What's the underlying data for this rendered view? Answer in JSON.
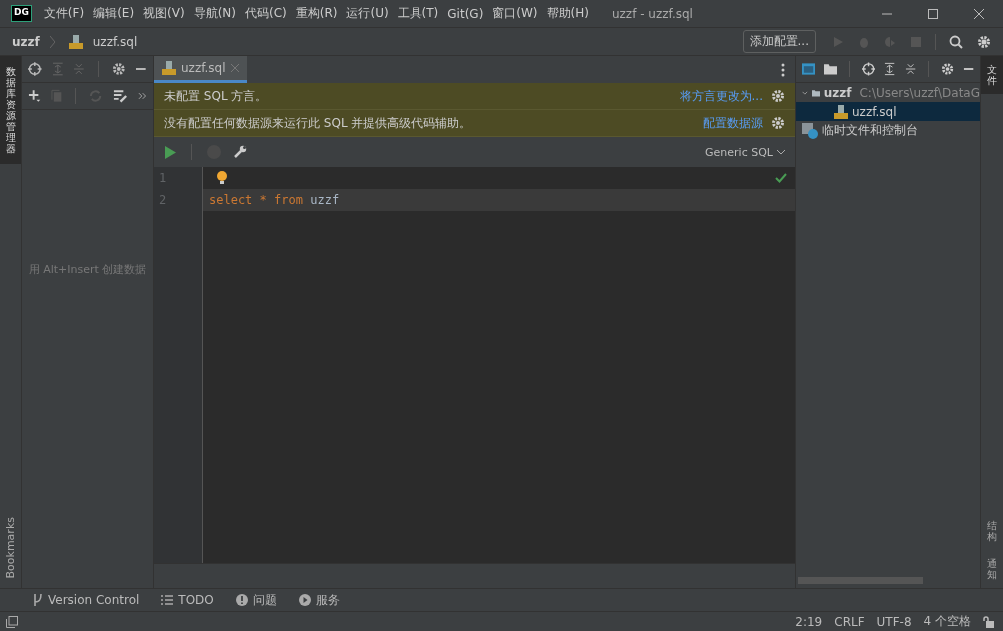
{
  "window": {
    "logo": "DG",
    "title": "uzzf - uzzf.sql"
  },
  "menu": [
    "文件(F)",
    "编辑(E)",
    "视图(V)",
    "导航(N)",
    "代码(C)",
    "重构(R)",
    "运行(U)",
    "工具(T)",
    "Git(G)",
    "窗口(W)",
    "帮助(H)"
  ],
  "breadcrumb": [
    "uzzf",
    "uzzf.sql"
  ],
  "run_config": {
    "label": "添加配置..."
  },
  "left_stripe": {
    "top": {
      "label": "数据库资源管理器",
      "selected": true
    },
    "bottom": {
      "label": "Bookmarks",
      "selected": false
    }
  },
  "db_panel": {
    "hint": "用 Alt+Insert 创建数据"
  },
  "editor_tabs": [
    {
      "label": "uzzf.sql",
      "selected": true
    }
  ],
  "banners": [
    {
      "text": "未配置 SQL 方言。",
      "link": "将方言更改为..."
    },
    {
      "text": "没有配置任何数据源来运行此 SQL 并提供高级代码辅助。",
      "link": "配置数据源"
    }
  ],
  "editor_toolbar": {
    "stop_disabled": true,
    "dialect": "Generic SQL"
  },
  "code_lines": [
    {
      "number": "1",
      "current": false
    },
    {
      "number": "2",
      "current": true,
      "tokens": [
        {
          "kind": "keyword",
          "text": "select"
        },
        {
          "kind": "keyword",
          "text": "*"
        },
        {
          "kind": "keyword",
          "text": "from"
        },
        {
          "kind": "ident",
          "text": "uzzf"
        }
      ]
    }
  ],
  "project_tree": [
    {
      "kind": "folder",
      "label": "uzzf",
      "path": "C:\\Users\\uzzf\\DataG",
      "expanded": true,
      "selected": false,
      "children": [
        {
          "kind": "sql",
          "label": "uzzf.sql",
          "selected": true
        }
      ]
    },
    {
      "kind": "scratch",
      "label": "临时文件和控制台",
      "selected": false
    }
  ],
  "right_stripe": [
    {
      "label": "文件",
      "selected": true
    },
    {
      "label": "结构",
      "selected": false
    },
    {
      "label": "通知",
      "selected": false
    }
  ],
  "tool_windows": [
    {
      "kind": "vcs",
      "label": "Version Control"
    },
    {
      "kind": "todo",
      "label": "TODO"
    },
    {
      "kind": "problems",
      "label": "问题"
    },
    {
      "kind": "services",
      "label": "服务"
    }
  ],
  "status_bar": [
    "2:19",
    "CRLF",
    "UTF-8",
    "4 个空格"
  ]
}
